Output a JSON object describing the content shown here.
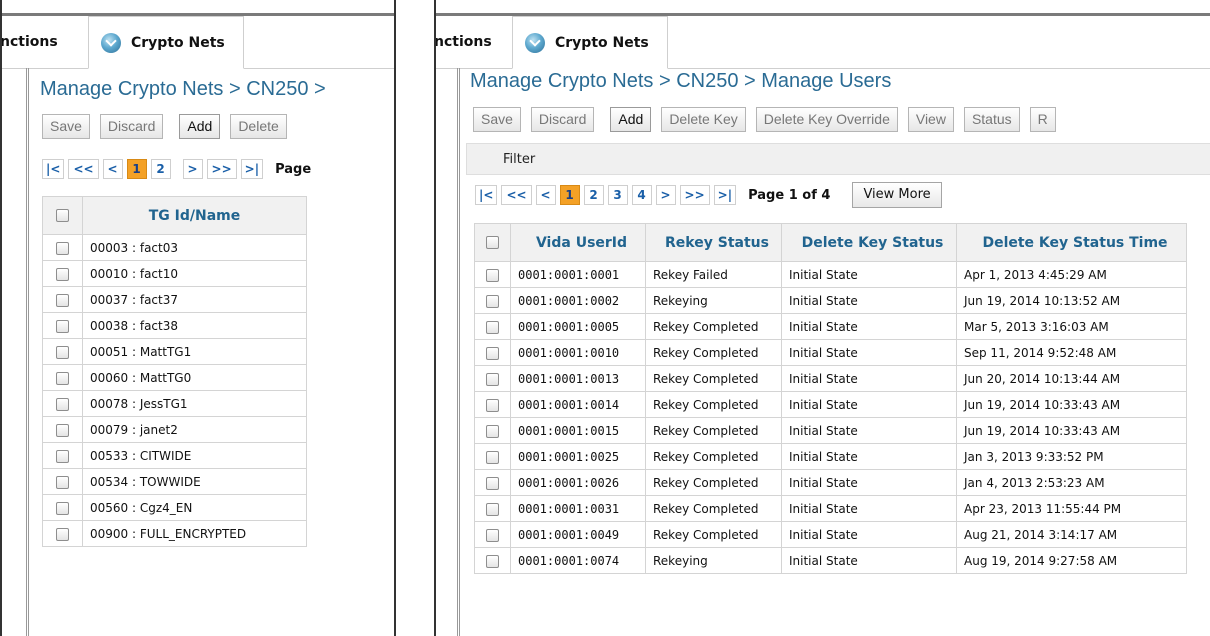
{
  "left": {
    "tabs": [
      {
        "label": "nctions"
      },
      {
        "label": "Crypto Nets"
      }
    ],
    "breadcrumb": "Manage Crypto Nets > CN250 >",
    "toolbar": {
      "save": "Save",
      "discard": "Discard",
      "add": "Add",
      "delete": "Delete"
    },
    "pager": {
      "first": "|<",
      "prev_group": "<<",
      "prev": "<",
      "pages": [
        "1",
        "2"
      ],
      "next": ">",
      "next_group": ">>",
      "last": ">|",
      "page_text": "Page"
    },
    "table": {
      "headers": [
        "TG Id/Name"
      ],
      "rows": [
        "00003 : fact03",
        "00010 : fact10",
        "00037 : fact37",
        "00038 : fact38",
        "00051 : MattTG1",
        "00060 : MattTG0",
        "00078 : JessTG1",
        "00079 : janet2",
        "00533 : CITWIDE",
        "00534 : TOWWIDE",
        "00560 : Cgz4_EN",
        "00900 : FULL_ENCRYPTED"
      ]
    }
  },
  "right": {
    "tabs": [
      {
        "label": "nctions"
      },
      {
        "label": "Crypto Nets"
      }
    ],
    "breadcrumb": "Manage Crypto Nets > CN250 > Manage Users",
    "toolbar": {
      "save": "Save",
      "discard": "Discard",
      "add": "Add",
      "delete_key": "Delete Key",
      "delete_key_override": "Delete Key Override",
      "view": "View",
      "status": "Status",
      "overflow": "R"
    },
    "filter": "Filter",
    "pager": {
      "first": "|<",
      "prev_group": "<<",
      "prev": "<",
      "pages": [
        "1",
        "2",
        "3",
        "4"
      ],
      "next": ">",
      "next_group": ">>",
      "last": ">|",
      "page_text": "Page 1 of 4",
      "view_more": "View More"
    },
    "table": {
      "headers": [
        "Vida UserId",
        "Rekey Status",
        "Delete Key Status",
        "Delete Key Status Time"
      ],
      "rows": [
        [
          "0001:0001:0001",
          "Rekey Failed",
          "Initial State",
          "Apr 1, 2013 4:45:29 AM"
        ],
        [
          "0001:0001:0002",
          "Rekeying",
          "Initial State",
          "Jun 19, 2014 10:13:52 AM"
        ],
        [
          "0001:0001:0005",
          "Rekey Completed",
          "Initial State",
          "Mar 5, 2013 3:16:03 AM"
        ],
        [
          "0001:0001:0010",
          "Rekey Completed",
          "Initial State",
          "Sep 11, 2014 9:52:48 AM"
        ],
        [
          "0001:0001:0013",
          "Rekey Completed",
          "Initial State",
          "Jun 20, 2014 10:13:44 AM"
        ],
        [
          "0001:0001:0014",
          "Rekey Completed",
          "Initial State",
          "Jun 19, 2014 10:33:43 AM"
        ],
        [
          "0001:0001:0015",
          "Rekey Completed",
          "Initial State",
          "Jun 19, 2014 10:33:43 AM"
        ],
        [
          "0001:0001:0025",
          "Rekey Completed",
          "Initial State",
          "Jan 3, 2013 9:33:52 PM"
        ],
        [
          "0001:0001:0026",
          "Rekey Completed",
          "Initial State",
          "Jan 4, 2013 2:53:23 AM"
        ],
        [
          "0001:0001:0031",
          "Rekey Completed",
          "Initial State",
          "Apr 23, 2013 11:55:44 PM"
        ],
        [
          "0001:0001:0049",
          "Rekey Completed",
          "Initial State",
          "Aug 21, 2014 3:14:17 AM"
        ],
        [
          "0001:0001:0074",
          "Rekeying",
          "Initial State",
          "Aug 19, 2014 9:27:58 AM"
        ]
      ]
    }
  },
  "colors": {
    "heading_blue": "#21648f",
    "breadcrumb_blue": "#2a6b94",
    "page_link_blue": "#1a5fa8",
    "current_page_orange": "#f4a126"
  },
  "icons": {
    "tab_icon": "crypto-nets-tab-icon"
  }
}
